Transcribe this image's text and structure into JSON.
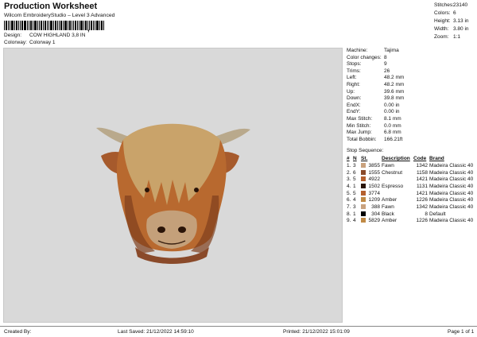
{
  "header": {
    "title": "Production Worksheet",
    "subtitle": "Wilcom EmbroideryStudio – Level 3 Advanced",
    "barcode_mark": ","
  },
  "meta": [
    {
      "label": "Design:",
      "value": "COW HIGHLAND 3,8 IN"
    },
    {
      "label": "Colorway:",
      "value": "Colorway 1"
    }
  ],
  "summary": [
    {
      "label": "Stitches:",
      "value": "23140"
    },
    {
      "label": "Colors:",
      "value": "6"
    },
    {
      "label": "Height:",
      "value": "3.13 in"
    },
    {
      "label": "Width:",
      "value": "3.80 in"
    },
    {
      "label": "Zoom:",
      "value": "1:1"
    }
  ],
  "machine_info": [
    {
      "label": "Machine:",
      "value": "Tajima"
    },
    {
      "label": "Color changes:",
      "value": "8"
    },
    {
      "label": "Stops:",
      "value": "9"
    },
    {
      "label": "Trims:",
      "value": "26"
    },
    {
      "label": "Left:",
      "value": "48.2 mm"
    },
    {
      "label": "Right:",
      "value": "48.2 mm"
    },
    {
      "label": "Up:",
      "value": "39.6 mm"
    },
    {
      "label": "Down:",
      "value": "39.8 mm"
    },
    {
      "label": "EndX:",
      "value": "0.00 in"
    },
    {
      "label": "EndY:",
      "value": "0.00 in"
    },
    {
      "label": "Max Stitch:",
      "value": "8.1 mm"
    },
    {
      "label": "Min Stitch:",
      "value": "0.0 mm"
    },
    {
      "label": "Max Jump:",
      "value": "6.8 mm"
    },
    {
      "label": "Total Bobbin:",
      "value": "166.21ft"
    }
  ],
  "stop_sequence": {
    "title": "Stop Sequence:",
    "headers": [
      "#",
      "N",
      "St.",
      "Description",
      "Code",
      "Brand"
    ],
    "rows": [
      {
        "n": "1.",
        "needle": "3",
        "color": "#c9a27e",
        "st": "3855",
        "desc": "Fawn",
        "code": "1342",
        "brand": "Madeira Classic 40"
      },
      {
        "n": "2.",
        "needle": "6",
        "color": "#8a4a2a",
        "st": "1555",
        "desc": "Chestnut",
        "code": "1158",
        "brand": "Madeira Classic 40"
      },
      {
        "n": "3.",
        "needle": "5",
        "color": "#b5602e",
        "st": "4922",
        "desc": "",
        "code": "1421",
        "brand": "Madeira Classic 40"
      },
      {
        "n": "4.",
        "needle": "1",
        "color": "#2a1408",
        "st": "1502",
        "desc": "Espresso",
        "code": "1131",
        "brand": "Madeira Classic 40"
      },
      {
        "n": "5.",
        "needle": "5",
        "color": "#b5602e",
        "st": "3774",
        "desc": "",
        "code": "1421",
        "brand": "Madeira Classic 40"
      },
      {
        "n": "6.",
        "needle": "4",
        "color": "#c08a45",
        "st": "1209",
        "desc": "Amber",
        "code": "1226",
        "brand": "Madeira Classic 40"
      },
      {
        "n": "7.",
        "needle": "3",
        "color": "#c9a27e",
        "st": "388",
        "desc": "Fawn",
        "code": "1342",
        "brand": "Madeira Classic 40"
      },
      {
        "n": "8.",
        "needle": "1",
        "color": "#000000",
        "st": "304",
        "desc": "Black",
        "code": "8",
        "brand": "Default"
      },
      {
        "n": "9.",
        "needle": "4",
        "color": "#c08a45",
        "st": "5829",
        "desc": "Amber",
        "code": "1226",
        "brand": "Madeira Classic 40"
      }
    ]
  },
  "footer": {
    "created_by": "Created By:",
    "last_saved": "Last Saved: 21/12/2022 14:59:10",
    "printed": "Printed: 21/12/2022 15:01:09",
    "page": "Page 1 of 1"
  }
}
